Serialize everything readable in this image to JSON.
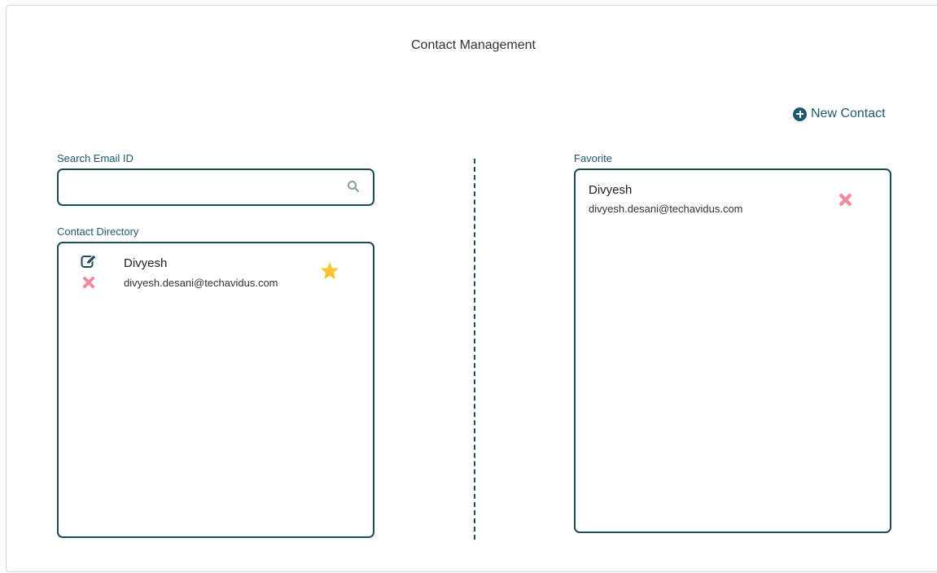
{
  "header": {
    "title": "Contact Management"
  },
  "toolbar": {
    "new_contact_label": "New Contact",
    "new_contact_icon": "plus-circle-icon"
  },
  "search": {
    "label": "Search Email ID",
    "value": "",
    "placeholder": "",
    "icon": "search-icon"
  },
  "directory": {
    "label": "Contact Directory",
    "contacts": [
      {
        "name": "Divyesh",
        "email": "divyesh.desani@techavidus.com",
        "favorite": true
      }
    ]
  },
  "favorites": {
    "label": "Favorite",
    "contacts": [
      {
        "name": "Divyesh",
        "email": "divyesh.desani@techavidus.com"
      }
    ]
  },
  "colors": {
    "accent": "#1e5a6e",
    "border": "#1e4a5a",
    "delete": "#f08aa0",
    "star": "#f7c531"
  }
}
